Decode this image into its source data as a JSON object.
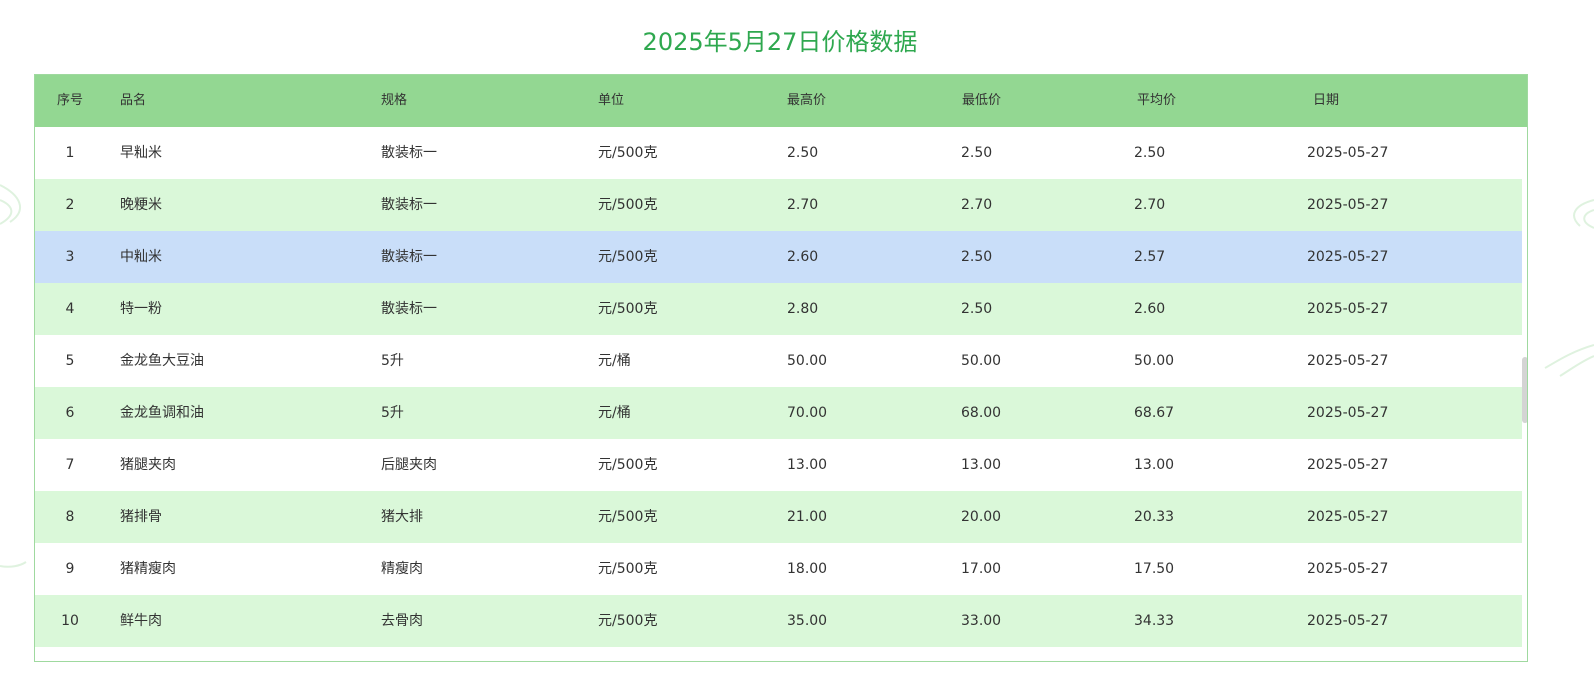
{
  "title": "2025年5月27日价格数据",
  "headers": [
    "序号",
    "品名",
    "规格",
    "单位",
    "最高价",
    "最低价",
    "平均价",
    "日期"
  ],
  "rows": [
    [
      "1",
      "早籼米",
      "散装标一",
      "元/500克",
      "2.50",
      "2.50",
      "2.50",
      "2025-05-27"
    ],
    [
      "2",
      "晚粳米",
      "散装标一",
      "元/500克",
      "2.70",
      "2.70",
      "2.70",
      "2025-05-27"
    ],
    [
      "3",
      "中籼米",
      "散装标一",
      "元/500克",
      "2.60",
      "2.50",
      "2.57",
      "2025-05-27"
    ],
    [
      "4",
      "特一粉",
      "散装标一",
      "元/500克",
      "2.80",
      "2.50",
      "2.60",
      "2025-05-27"
    ],
    [
      "5",
      "金龙鱼大豆油",
      "5升",
      "元/桶",
      "50.00",
      "50.00",
      "50.00",
      "2025-05-27"
    ],
    [
      "6",
      "金龙鱼调和油",
      "5升",
      "元/桶",
      "70.00",
      "68.00",
      "68.67",
      "2025-05-27"
    ],
    [
      "7",
      "猪腿夹肉",
      "后腿夹肉",
      "元/500克",
      "13.00",
      "13.00",
      "13.00",
      "2025-05-27"
    ],
    [
      "8",
      "猪排骨",
      "猪大排",
      "元/500克",
      "21.00",
      "20.00",
      "20.33",
      "2025-05-27"
    ],
    [
      "9",
      "猪精瘦肉",
      "精瘦肉",
      "元/500克",
      "18.00",
      "17.00",
      "17.50",
      "2025-05-27"
    ],
    [
      "10",
      "鲜牛肉",
      "去骨肉",
      "元/500克",
      "35.00",
      "33.00",
      "34.33",
      "2025-05-27"
    ]
  ],
  "colors": {
    "title": "#2fa84f",
    "header_bg": "#93d792",
    "row_alt_bg": "#daf8d9",
    "row_hover_bg": "#c9def9",
    "border": "#9fd99f"
  },
  "highlighted_row_index": 2
}
